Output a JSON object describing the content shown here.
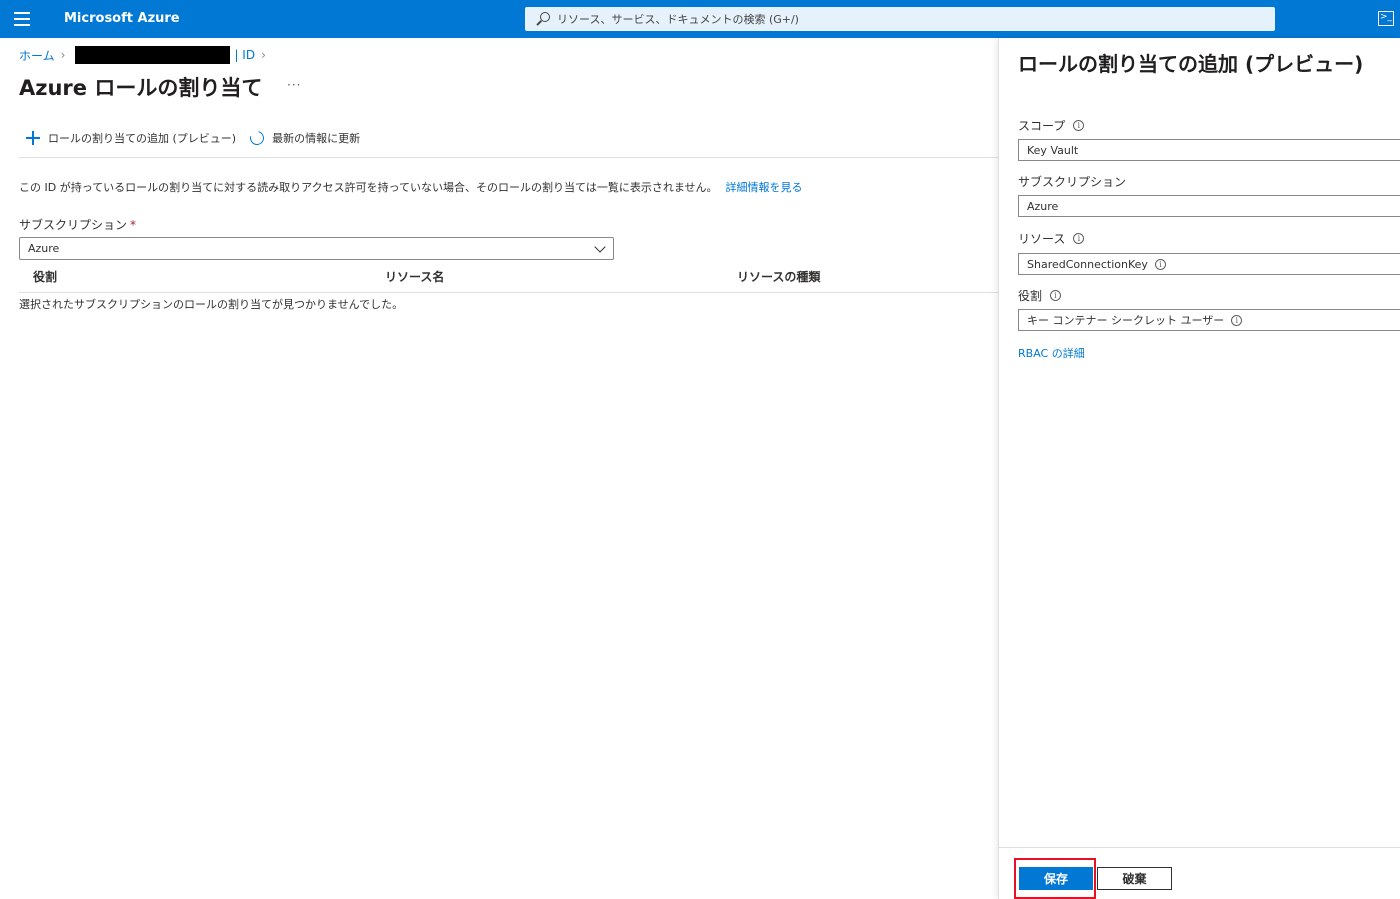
{
  "topbar": {
    "brand": "Microsoft Azure",
    "search_placeholder": "リソース、サービス、ドキュメントの検索 (G+/)",
    "cloudshell_glyph": ">_"
  },
  "breadcrumb": {
    "home": "ホーム",
    "id_label": "| ID"
  },
  "page": {
    "title": "Azure ロールの割り当て",
    "more": "···"
  },
  "command_bar": {
    "add_label": "ロールの割り当ての追加 (プレビュー)",
    "refresh_label": "最新の情報に更新"
  },
  "info": {
    "text": "この ID が持っているロールの割り当てに対する読み取りアクセス許可を持っていない場合、そのロールの割り当ては一覧に表示されません。",
    "link": "詳細情報を見る"
  },
  "subscription": {
    "label": "サブスクリプション",
    "required_mark": "*",
    "value": "Azure"
  },
  "table": {
    "columns": [
      "役割",
      "リソース名",
      "リソースの種類"
    ],
    "empty_message": "選択されたサブスクリプションのロールの割り当てが見つかりませんでした。"
  },
  "panel": {
    "title": "ロールの割り当ての追加 (プレビュー)",
    "scope_label": "スコープ",
    "scope_value": "Key Vault",
    "subscription_label": "サブスクリプション",
    "subscription_value": "Azure",
    "resource_label": "リソース",
    "resource_value": "SharedConnectionKey",
    "role_label": "役割",
    "role_value": "キー コンテナー シークレット ユーザー",
    "rbac_link": "RBAC の詳細",
    "info_glyph": "i",
    "save_label": "保存",
    "discard_label": "破棄"
  },
  "colors": {
    "accent": "#0078d4",
    "highlight": "#e81123"
  }
}
